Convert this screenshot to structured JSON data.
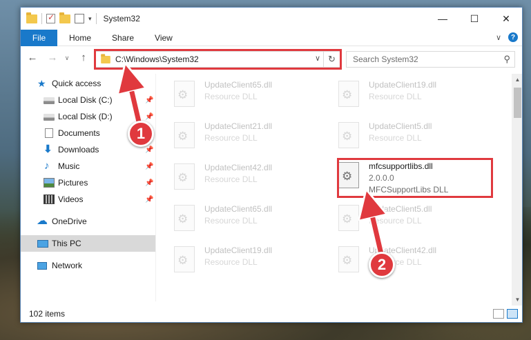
{
  "window": {
    "title": "System32",
    "minimize_glyph": "—",
    "maximize_glyph": "☐",
    "close_glyph": "✕"
  },
  "ribbon": {
    "file_tab": "File",
    "tabs": [
      "Home",
      "Share",
      "View"
    ],
    "expand_glyph": "∨",
    "help_glyph": "?"
  },
  "address_bar": {
    "path": "C:\\Windows\\System32",
    "back_glyph": "←",
    "forward_glyph": "→",
    "recent_glyph": "∨",
    "up_glyph": "↑",
    "dropdown_glyph": "∨",
    "refresh_glyph": "↻"
  },
  "search": {
    "placeholder": "Search System32",
    "icon_glyph": "⚲"
  },
  "nav_pane": {
    "items": [
      {
        "label": "Quick access",
        "icon": "star-icon",
        "pinned": false
      },
      {
        "label": "Local Disk (C:)",
        "icon": "drive-icon",
        "pinned": true
      },
      {
        "label": "Local Disk (D:)",
        "icon": "drive-icon",
        "pinned": true
      },
      {
        "label": "Documents",
        "icon": "documents-icon",
        "pinned": true
      },
      {
        "label": "Downloads",
        "icon": "downloads-icon",
        "pinned": true
      },
      {
        "label": "Music",
        "icon": "music-icon",
        "pinned": true
      },
      {
        "label": "Pictures",
        "icon": "pictures-icon",
        "pinned": true
      },
      {
        "label": "Videos",
        "icon": "videos-icon",
        "pinned": true
      },
      {
        "label": "OneDrive",
        "icon": "cloud-icon",
        "pinned": false
      },
      {
        "label": "This PC",
        "icon": "pc-icon",
        "pinned": false,
        "selected": true
      },
      {
        "label": "Network",
        "icon": "network-icon",
        "pinned": false
      }
    ],
    "pin_glyph": "📌"
  },
  "files": [
    {
      "name": "UpdateClient65.dll",
      "line2": "Resource DLL",
      "line3": "",
      "dimmed": true
    },
    {
      "name": "UpdateClient19.dll",
      "line2": "Resource DLL",
      "line3": "",
      "dimmed": true
    },
    {
      "name": "UpdateClient21.dll",
      "line2": "Resource DLL",
      "line3": "",
      "dimmed": true
    },
    {
      "name": "UpdateClient5.dll",
      "line2": "Resource DLL",
      "line3": "",
      "dimmed": true
    },
    {
      "name": "UpdateClient42.dll",
      "line2": "Resource DLL",
      "line3": "",
      "dimmed": true
    },
    {
      "name": "mfcsupportlibs.dll",
      "line2": "2.0.0.0",
      "line3": "MFCSupportLibs DLL",
      "dimmed": false
    },
    {
      "name": "UpdateClient65.dll",
      "line2": "Resource DLL",
      "line3": "",
      "dimmed": true
    },
    {
      "name": "UpdateClient5.dll",
      "line2": "Resource DLL",
      "line3": "",
      "dimmed": true
    },
    {
      "name": "UpdateClient19.dll",
      "line2": "Resource DLL",
      "line3": "",
      "dimmed": true
    },
    {
      "name": "UpdateClient42.dll",
      "line2": "Resource DLL",
      "line3": "",
      "dimmed": true
    }
  ],
  "status_bar": {
    "item_count": "102 items"
  },
  "scrollbar": {
    "up_glyph": "▲",
    "down_glyph": "▼"
  },
  "annotations": {
    "step1": "1",
    "step2": "2",
    "color": "#e0393e"
  },
  "colors": {
    "accent": "#1979ca",
    "highlight": "#e0393e"
  }
}
